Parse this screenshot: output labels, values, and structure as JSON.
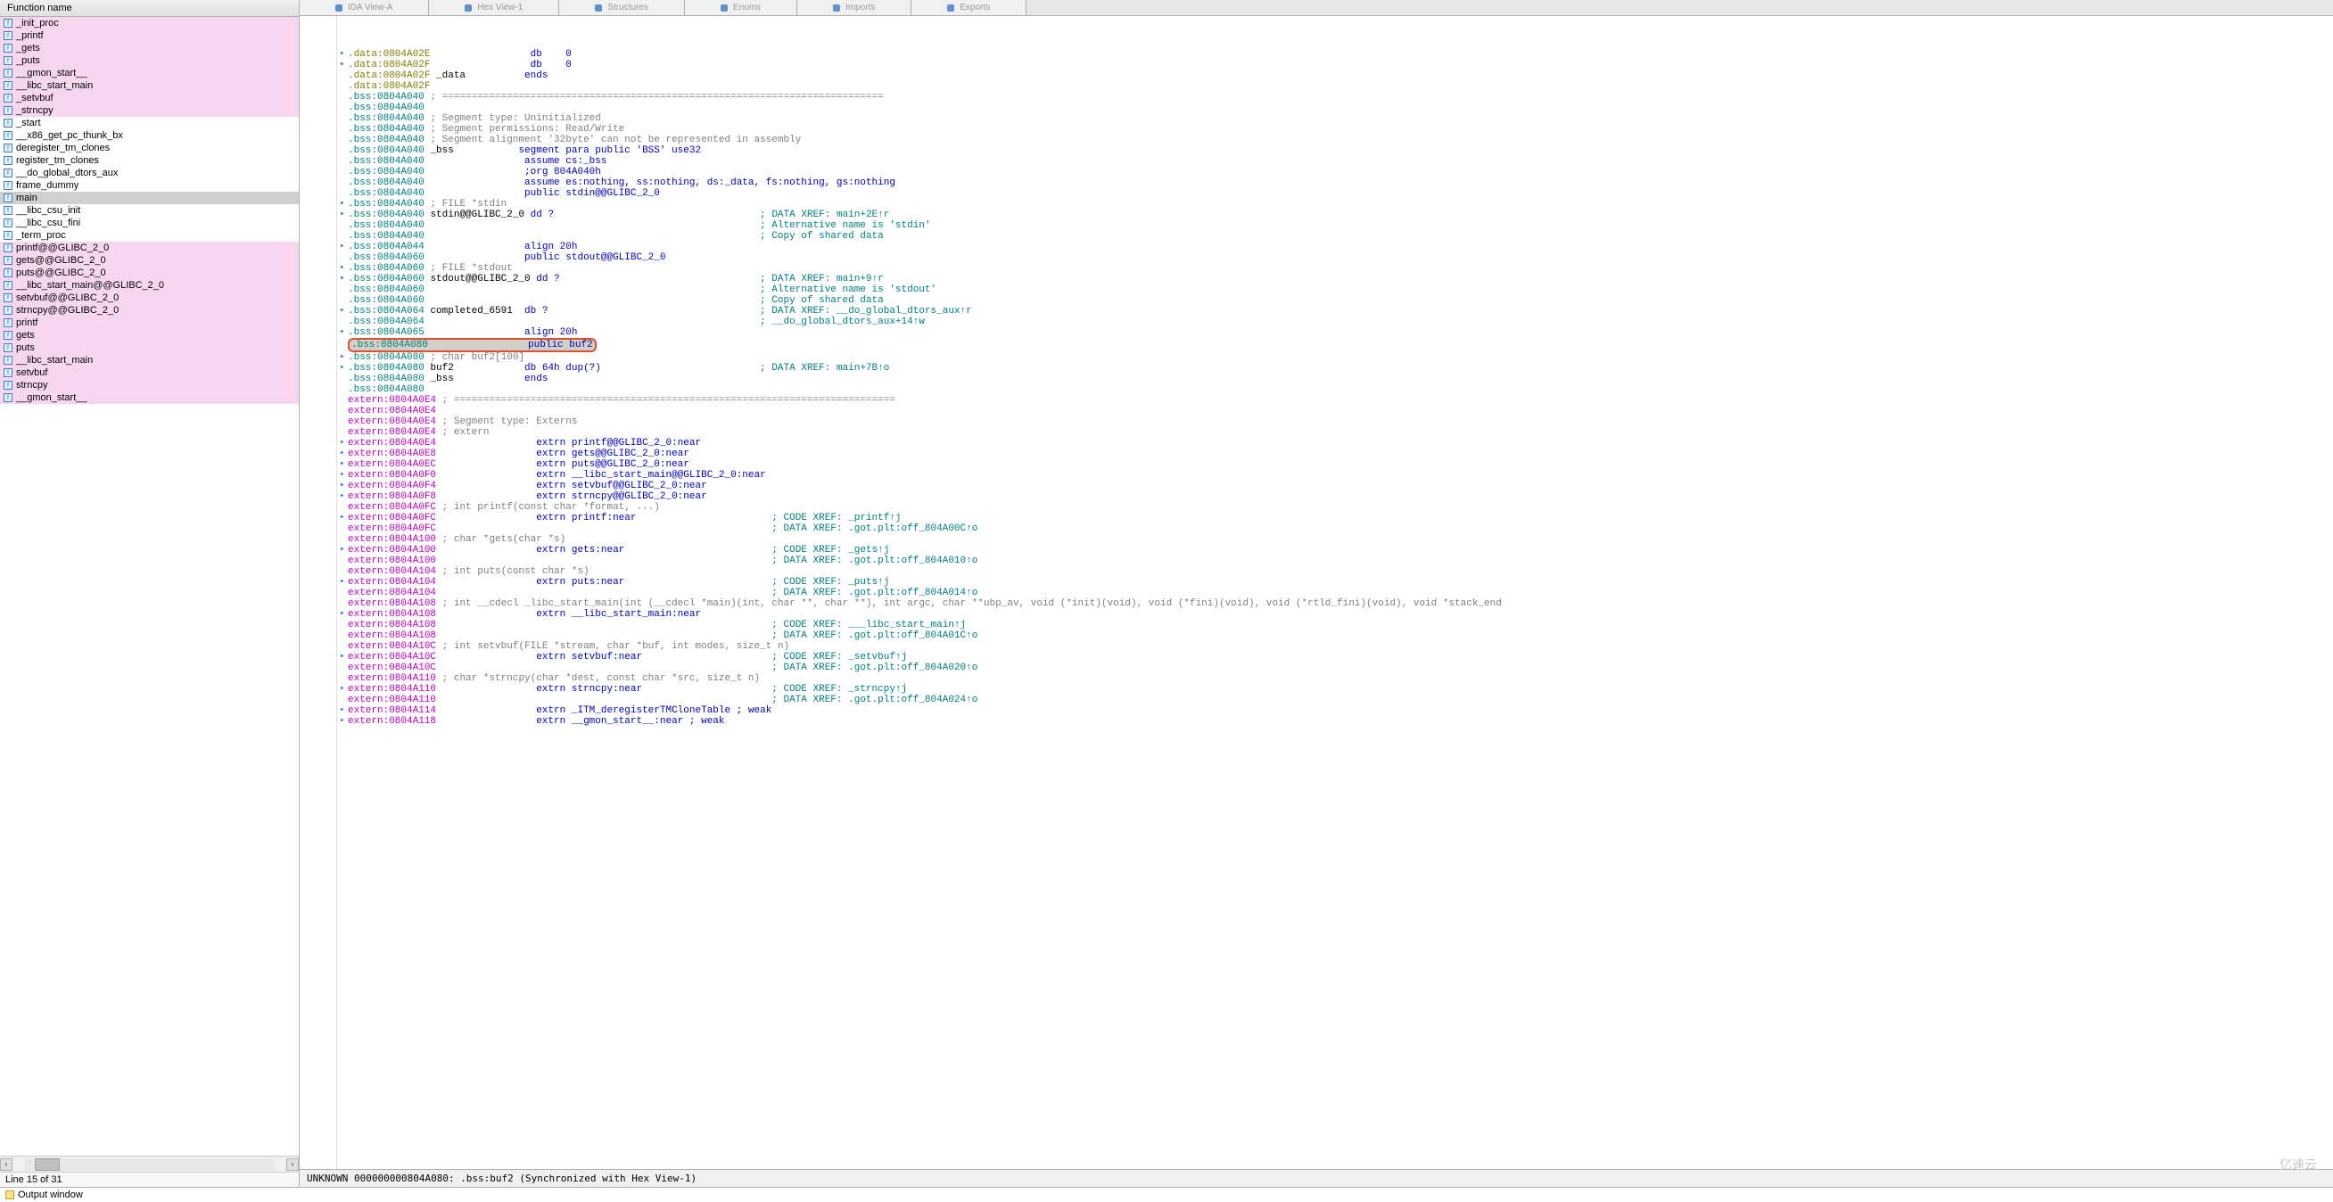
{
  "left": {
    "header": "Function name",
    "items": [
      {
        "label": "_init_proc",
        "pink": true
      },
      {
        "label": "_printf",
        "pink": true
      },
      {
        "label": "_gets",
        "pink": true
      },
      {
        "label": "_puts",
        "pink": true
      },
      {
        "label": "__gmon_start__",
        "pink": true
      },
      {
        "label": "__libc_start_main",
        "pink": true
      },
      {
        "label": "_setvbuf",
        "pink": true
      },
      {
        "label": "_strncpy",
        "pink": true
      },
      {
        "label": "_start",
        "pink": false
      },
      {
        "label": "__x86_get_pc_thunk_bx",
        "pink": false
      },
      {
        "label": "deregister_tm_clones",
        "pink": false
      },
      {
        "label": "register_tm_clones",
        "pink": false
      },
      {
        "label": "__do_global_dtors_aux",
        "pink": false
      },
      {
        "label": "frame_dummy",
        "pink": false
      },
      {
        "label": "main",
        "pink": false,
        "sel": true
      },
      {
        "label": "__libc_csu_init",
        "pink": false
      },
      {
        "label": "__libc_csu_fini",
        "pink": false
      },
      {
        "label": "_term_proc",
        "pink": false
      },
      {
        "label": "printf@@GLIBC_2_0",
        "pink": true
      },
      {
        "label": "gets@@GLIBC_2_0",
        "pink": true
      },
      {
        "label": "puts@@GLIBC_2_0",
        "pink": true
      },
      {
        "label": "__libc_start_main@@GLIBC_2_0",
        "pink": true
      },
      {
        "label": "setvbuf@@GLIBC_2_0",
        "pink": true
      },
      {
        "label": "strncpy@@GLIBC_2_0",
        "pink": true
      },
      {
        "label": "printf",
        "pink": true
      },
      {
        "label": "gets",
        "pink": true
      },
      {
        "label": "puts",
        "pink": true
      },
      {
        "label": "__libc_start_main",
        "pink": true
      },
      {
        "label": "setvbuf",
        "pink": true
      },
      {
        "label": "strncpy",
        "pink": true
      },
      {
        "label": "__gmon_start__",
        "pink": true
      }
    ],
    "status": "Line 15 of 31"
  },
  "tabs": [
    "IDA View-A",
    "Hex View-1",
    "Structures",
    "Enums",
    "Imports",
    "Exports"
  ],
  "lines": [
    {
      "d": "•",
      "seg": "data",
      "addr": "0804A02E",
      "txt": "                db    0"
    },
    {
      "d": "•",
      "seg": "data",
      "addr": "0804A02F",
      "txt": "                db    0"
    },
    {
      "d": " ",
      "seg": "data",
      "addr": "0804A02F",
      "name": "_data",
      "txt": "          ends"
    },
    {
      "d": " ",
      "seg": "data",
      "addr": "0804A02F",
      "txt": ""
    },
    {
      "d": " ",
      "seg": "bss",
      "addr": "0804A040",
      "cmt": "; ==========================================================================="
    },
    {
      "d": " ",
      "seg": "bss",
      "addr": "0804A040",
      "txt": ""
    },
    {
      "d": " ",
      "seg": "bss",
      "addr": "0804A040",
      "cmt": "; Segment type: Uninitialized"
    },
    {
      "d": " ",
      "seg": "bss",
      "addr": "0804A040",
      "cmt": "; Segment permissions: Read/Write"
    },
    {
      "d": " ",
      "seg": "bss",
      "addr": "0804A040",
      "cmt": "; Segment alignment '32byte' can not be represented in assembly"
    },
    {
      "d": " ",
      "seg": "bss",
      "addr": "0804A040",
      "name": "_bss",
      "txt": "           segment para public 'BSS' use32"
    },
    {
      "d": " ",
      "seg": "bss",
      "addr": "0804A040",
      "txt": "                assume cs:_bss"
    },
    {
      "d": " ",
      "seg": "bss",
      "addr": "0804A040",
      "txt": "                ;org 804A040h"
    },
    {
      "d": " ",
      "seg": "bss",
      "addr": "0804A040",
      "txt": "                assume es:nothing, ss:nothing, ds:_data, fs:nothing, gs:nothing"
    },
    {
      "d": " ",
      "seg": "bss",
      "addr": "0804A040",
      "txt": "                public stdin@@GLIBC_2_0"
    },
    {
      "d": "•",
      "seg": "bss",
      "addr": "0804A040",
      "cmt": "; FILE *stdin"
    },
    {
      "d": "•",
      "seg": "bss",
      "addr": "0804A040",
      "name": "stdin@@GLIBC_2_0",
      "txt": " dd ?",
      "xref": "; DATA XREF: main+2E↑r"
    },
    {
      "d": " ",
      "seg": "bss",
      "addr": "0804A040",
      "xref": "; Alternative name is 'stdin'"
    },
    {
      "d": " ",
      "seg": "bss",
      "addr": "0804A040",
      "xref": "; Copy of shared data"
    },
    {
      "d": "•",
      "seg": "bss",
      "addr": "0804A044",
      "txt": "                align 20h"
    },
    {
      "d": " ",
      "seg": "bss",
      "addr": "0804A060",
      "txt": "                public stdout@@GLIBC_2_0"
    },
    {
      "d": "•",
      "seg": "bss",
      "addr": "0804A060",
      "cmt": "; FILE *stdout"
    },
    {
      "d": "•",
      "seg": "bss",
      "addr": "0804A060",
      "name": "stdout@@GLIBC_2_0",
      "txt": " dd ?",
      "xref": "; DATA XREF: main+9↑r"
    },
    {
      "d": " ",
      "seg": "bss",
      "addr": "0804A060",
      "xref": "; Alternative name is 'stdout'"
    },
    {
      "d": " ",
      "seg": "bss",
      "addr": "0804A060",
      "xref": "; Copy of shared data"
    },
    {
      "d": "•",
      "seg": "bss",
      "addr": "0804A064",
      "name": "completed_6591",
      "txt": "  db ?",
      "xref": "; DATA XREF: __do_global_dtors_aux↑r"
    },
    {
      "d": " ",
      "seg": "bss",
      "addr": "0804A064",
      "xref": "; __do_global_dtors_aux+14↑w"
    },
    {
      "d": "•",
      "seg": "bss",
      "addr": "0804A065",
      "txt": "                align 20h"
    },
    {
      "hl": true,
      "seg": "bss",
      "addr": "0804A080",
      "txt": "                public buf2"
    },
    {
      "d": "•",
      "seg": "bss",
      "addr": "0804A080",
      "cmt": "; char buf2[100]"
    },
    {
      "d": "•",
      "seg": "bss",
      "addr": "0804A080",
      "name": "buf2",
      "txt": "            db 64h dup(?)",
      "xref": "; DATA XREF: main+7B↑o"
    },
    {
      "d": " ",
      "seg": "bss",
      "addr": "0804A080",
      "name": "_bss",
      "txt": "            ends"
    },
    {
      "d": " ",
      "seg": "bss",
      "addr": "0804A080",
      "txt": ""
    },
    {
      "d": " ",
      "seg": "ext",
      "addr": "0804A0E4",
      "cmt": "; ==========================================================================="
    },
    {
      "d": " ",
      "seg": "ext",
      "addr": "0804A0E4",
      "txt": ""
    },
    {
      "d": " ",
      "seg": "ext",
      "addr": "0804A0E4",
      "cmt": "; Segment type: Externs"
    },
    {
      "d": " ",
      "seg": "ext",
      "addr": "0804A0E4",
      "cmt": "; extern"
    },
    {
      "d": "•",
      "seg": "ext",
      "addr": "0804A0E4",
      "txt": "                extrn printf@@GLIBC_2_0:near"
    },
    {
      "d": "•",
      "seg": "ext",
      "addr": "0804A0E8",
      "txt": "                extrn gets@@GLIBC_2_0:near"
    },
    {
      "d": "•",
      "seg": "ext",
      "addr": "0804A0EC",
      "txt": "                extrn puts@@GLIBC_2_0:near"
    },
    {
      "d": "•",
      "seg": "ext",
      "addr": "0804A0F0",
      "txt": "                extrn __libc_start_main@@GLIBC_2_0:near"
    },
    {
      "d": "•",
      "seg": "ext",
      "addr": "0804A0F4",
      "txt": "                extrn setvbuf@@GLIBC_2_0:near"
    },
    {
      "d": "•",
      "seg": "ext",
      "addr": "0804A0F8",
      "txt": "                extrn strncpy@@GLIBC_2_0:near"
    },
    {
      "d": " ",
      "seg": "ext",
      "addr": "0804A0FC",
      "cmt": "; int printf(const char *format, ...)"
    },
    {
      "d": "•",
      "seg": "ext",
      "addr": "0804A0FC",
      "txt": "                extrn printf:near",
      "xref": "; CODE XREF: _printf↑j"
    },
    {
      "d": " ",
      "seg": "ext",
      "addr": "0804A0FC",
      "xref": "; DATA XREF: .got.plt:off_804A00C↑o"
    },
    {
      "d": " ",
      "seg": "ext",
      "addr": "0804A100",
      "cmt": "; char *gets(char *s)"
    },
    {
      "d": "•",
      "seg": "ext",
      "addr": "0804A100",
      "txt": "                extrn gets:near",
      "xref": "; CODE XREF: _gets↑j"
    },
    {
      "d": " ",
      "seg": "ext",
      "addr": "0804A100",
      "xref": "; DATA XREF: .got.plt:off_804A010↑o"
    },
    {
      "d": " ",
      "seg": "ext",
      "addr": "0804A104",
      "cmt": "; int puts(const char *s)"
    },
    {
      "d": "•",
      "seg": "ext",
      "addr": "0804A104",
      "txt": "                extrn puts:near",
      "xref": "; CODE XREF: _puts↑j"
    },
    {
      "d": " ",
      "seg": "ext",
      "addr": "0804A104",
      "xref": "; DATA XREF: .got.plt:off_804A014↑o"
    },
    {
      "d": " ",
      "seg": "ext",
      "addr": "0804A108",
      "cmt": "; int __cdecl _libc_start_main(int (__cdecl *main)(int, char **, char **), int argc, char **ubp_av, void (*init)(void), void (*fini)(void), void (*rtld_fini)(void), void *stack_end"
    },
    {
      "d": "•",
      "seg": "ext",
      "addr": "0804A108",
      "txt": "                extrn __libc_start_main:near"
    },
    {
      "d": " ",
      "seg": "ext",
      "addr": "0804A108",
      "xref": "; CODE XREF: ___libc_start_main↑j"
    },
    {
      "d": " ",
      "seg": "ext",
      "addr": "0804A108",
      "xref": "; DATA XREF: .got.plt:off_804A01C↑o"
    },
    {
      "d": " ",
      "seg": "ext",
      "addr": "0804A10C",
      "cmt": "; int setvbuf(FILE *stream, char *buf, int modes, size_t n)"
    },
    {
      "d": "•",
      "seg": "ext",
      "addr": "0804A10C",
      "txt": "                extrn setvbuf:near",
      "xref": "; CODE XREF: _setvbuf↑j"
    },
    {
      "d": " ",
      "seg": "ext",
      "addr": "0804A10C",
      "xref": "; DATA XREF: .got.plt:off_804A020↑o"
    },
    {
      "d": " ",
      "seg": "ext",
      "addr": "0804A110",
      "cmt": "; char *strncpy(char *dest, const char *src, size_t n)"
    },
    {
      "d": "•",
      "seg": "ext",
      "addr": "0804A110",
      "txt": "                extrn strncpy:near",
      "xref": "; CODE XREF: _strncpy↑j"
    },
    {
      "d": " ",
      "seg": "ext",
      "addr": "0804A110",
      "xref": "; DATA XREF: .got.plt:off_804A024↑o"
    },
    {
      "d": "•",
      "seg": "ext",
      "addr": "0804A114",
      "txt": "                extrn _ITM_deregisterTMCloneTable ; weak"
    },
    {
      "d": "•",
      "seg": "ext",
      "addr": "0804A118",
      "txt": "                extrn __gmon_start__:near ; weak"
    }
  ],
  "statusRight": "UNKNOWN 000000000804A080: .bss:buf2 (Synchronized with Hex View-1)",
  "output": "Output window",
  "watermark": "亿速云"
}
